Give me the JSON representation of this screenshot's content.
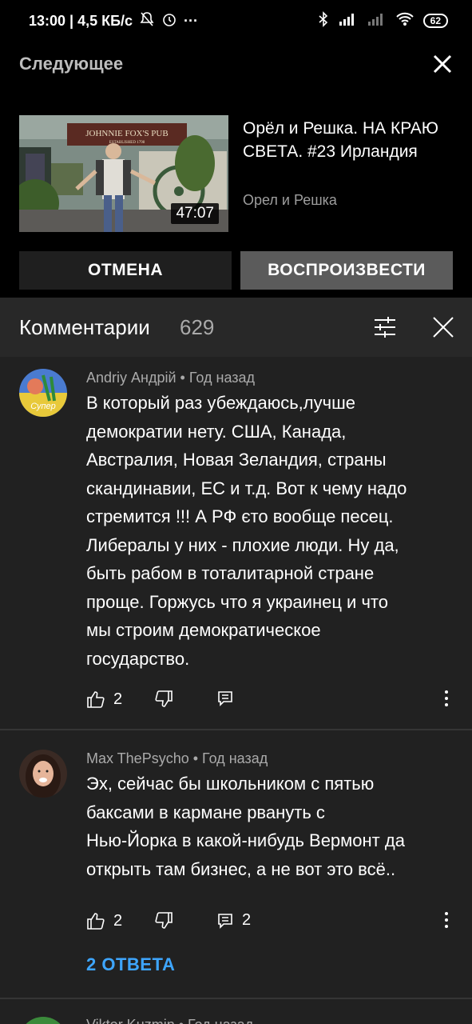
{
  "status_bar": {
    "time_speed": "13:00 | 4,5 КБ/с",
    "more": "···",
    "battery": "62"
  },
  "up_next": {
    "heading": "Следующее",
    "video_title": "Орёл и Решка. НА КРАЮ СВЕТА. #23 Ирландия",
    "channel": "Орел и Решка",
    "duration": "47:07",
    "thumbnail_sign": "JOHNNIE FOX'S PUB",
    "thumbnail_sign_sub": "ESTABLISHED 1798",
    "cancel_label": "ОТМЕНА",
    "play_label": "ВОСПРОИЗВЕСТИ"
  },
  "comments": {
    "title": "Комментарии",
    "count": "629",
    "items": [
      {
        "author_time": "Andriy Андрій • Год назад",
        "avatar_text": "Супер",
        "text": "В который раз убеждаюсь,лучше\nдемократии нету. США, Канада,\nАвстралия, Новая Зеландия, страны\nскандинавии, ЕС и т.д. Вот к чему надо\nстремится !!! А РФ єто вообще песец.\nЛибералы у них - плохие люди. Ну да,\nбыть рабом  в тоталитарной стране\nпроще. Горжусь что я украинец и что\nмы строим демократическое\nгосударство.",
        "likes": "2",
        "replies": ""
      },
      {
        "author_time": "Max ThePsycho • Год назад",
        "text": "Эх, сейчас бы школьником с пятью\nбаксами в кармане рвануть с\nНью-Йорка в какой-нибудь Вермонт да\nоткрыть там бизнес, а не вот это всё..",
        "likes": "2",
        "replies": "2",
        "replies_link": "2 ОТВЕТА"
      },
      {
        "author_time": "Viktor Kuzmin • Год назад"
      }
    ]
  },
  "colors": {
    "background_top": "#000000",
    "comments_bg": "#212121",
    "header_bg": "#282828",
    "link_blue": "#3ea6ff"
  }
}
